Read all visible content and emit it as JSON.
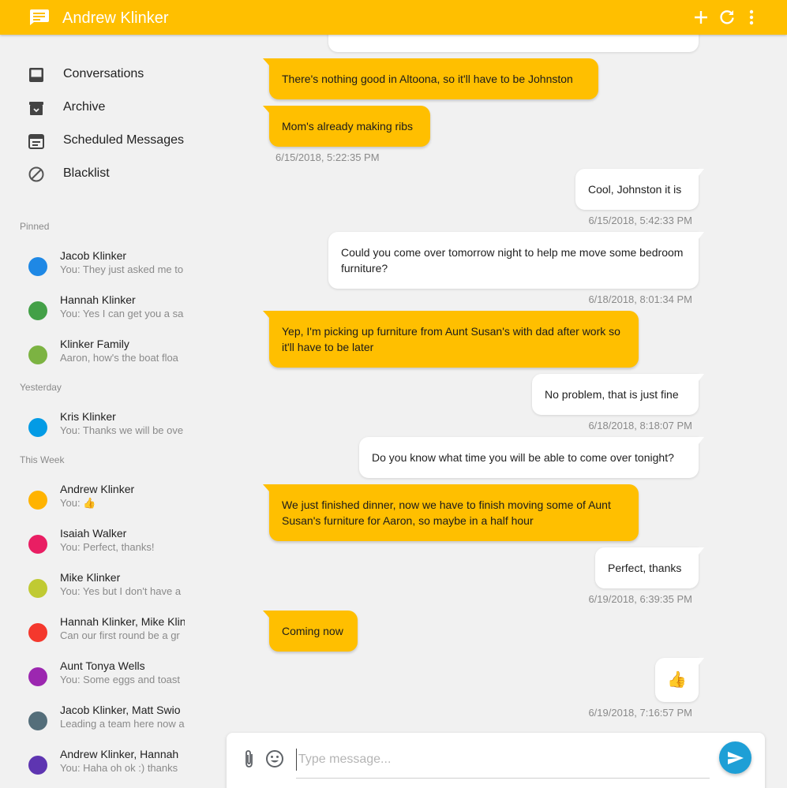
{
  "toolbar": {
    "title": "Andrew Klinker",
    "color": "#ffbf00",
    "icons": [
      "message-icon",
      "add-icon",
      "refresh-icon",
      "more-vert-icon"
    ]
  },
  "nav": [
    {
      "label": "Conversations",
      "icon": "inbox-icon"
    },
    {
      "label": "Archive",
      "icon": "archive-icon"
    },
    {
      "label": "Scheduled Messages",
      "icon": "calendar-icon"
    },
    {
      "label": "Blacklist",
      "icon": "block-icon"
    }
  ],
  "sections": {
    "pinned": "Pinned",
    "yesterday": "Yesterday",
    "this_week": "This Week"
  },
  "conversations": [
    {
      "name": "Jacob Klinker",
      "snippet": "You: They just asked me to",
      "color": "#1e88e5"
    },
    {
      "name": "Hannah Klinker",
      "snippet": "You: Yes I can get you a sa",
      "color": "#43a047"
    },
    {
      "name": "Klinker Family",
      "snippet": "Aaron, how's the boat floa",
      "color": "#7cb342"
    },
    {
      "name": "Kris Klinker",
      "snippet": "You: Thanks we will be ove",
      "color": "#039be5"
    },
    {
      "name": "Andrew Klinker",
      "snippet": "You: 👍",
      "color": "#ffb300"
    },
    {
      "name": "Isaiah Walker",
      "snippet": "You: Perfect, thanks!",
      "color": "#e91e63"
    },
    {
      "name": "Mike Klinker",
      "snippet": "You: Yes but I don't have a",
      "color": "#c0ca33"
    },
    {
      "name": "Hannah Klinker, Mike Klin",
      "snippet": "Can our first round be a gr",
      "color": "#f4382d"
    },
    {
      "name": "Aunt Tonya Wells",
      "snippet": "You: Some eggs and toast",
      "color": "#9c27b0"
    },
    {
      "name": "Jacob Klinker, Matt Swio",
      "snippet": "Leading a team here now a",
      "color": "#546e7a"
    },
    {
      "name": "Andrew Klinker, Hannah",
      "snippet": "You: Haha oh ok :) thanks",
      "color": "#5e35b1"
    }
  ],
  "messages": [
    {
      "text": "",
      "dir": "out"
    },
    {
      "text": "There's nothing good in Altoona, so it'll have to be Johnston",
      "dir": "in"
    },
    {
      "text": "Mom's already making ribs",
      "dir": "in",
      "time": "6/15/2018, 5:22:35 PM"
    },
    {
      "text": "Cool, Johnston it is",
      "dir": "out",
      "time": "6/15/2018, 5:42:33 PM"
    },
    {
      "text": "Could you come over tomorrow night to help me move some bedroom furniture?",
      "dir": "out",
      "time": "6/18/2018, 8:01:34 PM"
    },
    {
      "text": "Yep, I'm picking up furniture from Aunt Susan's with dad after work so it'll have to be later",
      "dir": "in"
    },
    {
      "text": "No problem, that is just fine",
      "dir": "out",
      "time": "6/18/2018, 8:18:07 PM"
    },
    {
      "text": "Do you know what time you will be able to come over tonight?",
      "dir": "out"
    },
    {
      "text": "We just finished dinner, now we have to finish moving some of Aunt Susan's furniture for Aaron, so maybe in a half hour",
      "dir": "in"
    },
    {
      "text": "Perfect, thanks",
      "dir": "out",
      "time": "6/19/2018, 6:39:35 PM"
    },
    {
      "text": "Coming now",
      "dir": "in"
    },
    {
      "text": "👍",
      "dir": "out",
      "time": "6/19/2018, 7:16:57 PM"
    }
  ],
  "compose": {
    "placeholder": "Type message...",
    "attach_icon": "attach-icon",
    "emoji_icon": "emoji-icon",
    "send_icon": "send-icon",
    "send_color": "#1e9fd6"
  }
}
